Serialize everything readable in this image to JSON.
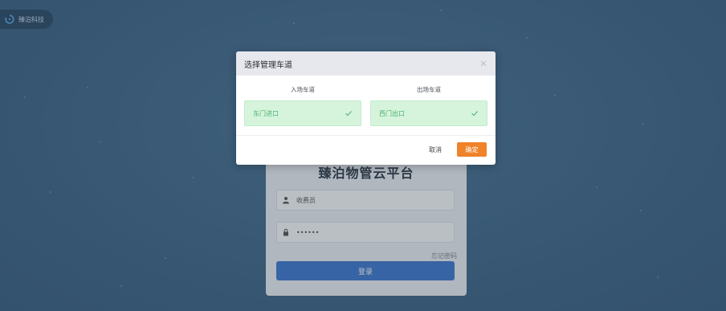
{
  "brand": {
    "name": "臻泊科技"
  },
  "login": {
    "title": "臻泊物管云平台",
    "username": "收费员",
    "password_mask": "••••••",
    "forgot": "忘记密码",
    "submit": "登录"
  },
  "modal": {
    "title": "选择管理车道",
    "entry_label": "入场车道",
    "exit_label": "出场车道",
    "entry_lane": "东门进口",
    "exit_lane": "西门出口",
    "cancel": "取消",
    "confirm": "确定"
  },
  "colors": {
    "accent": "#f0832a",
    "selected_bg": "#d6f4dc",
    "selected_text": "#4caf6e",
    "login_button": "#3f7ad0"
  }
}
